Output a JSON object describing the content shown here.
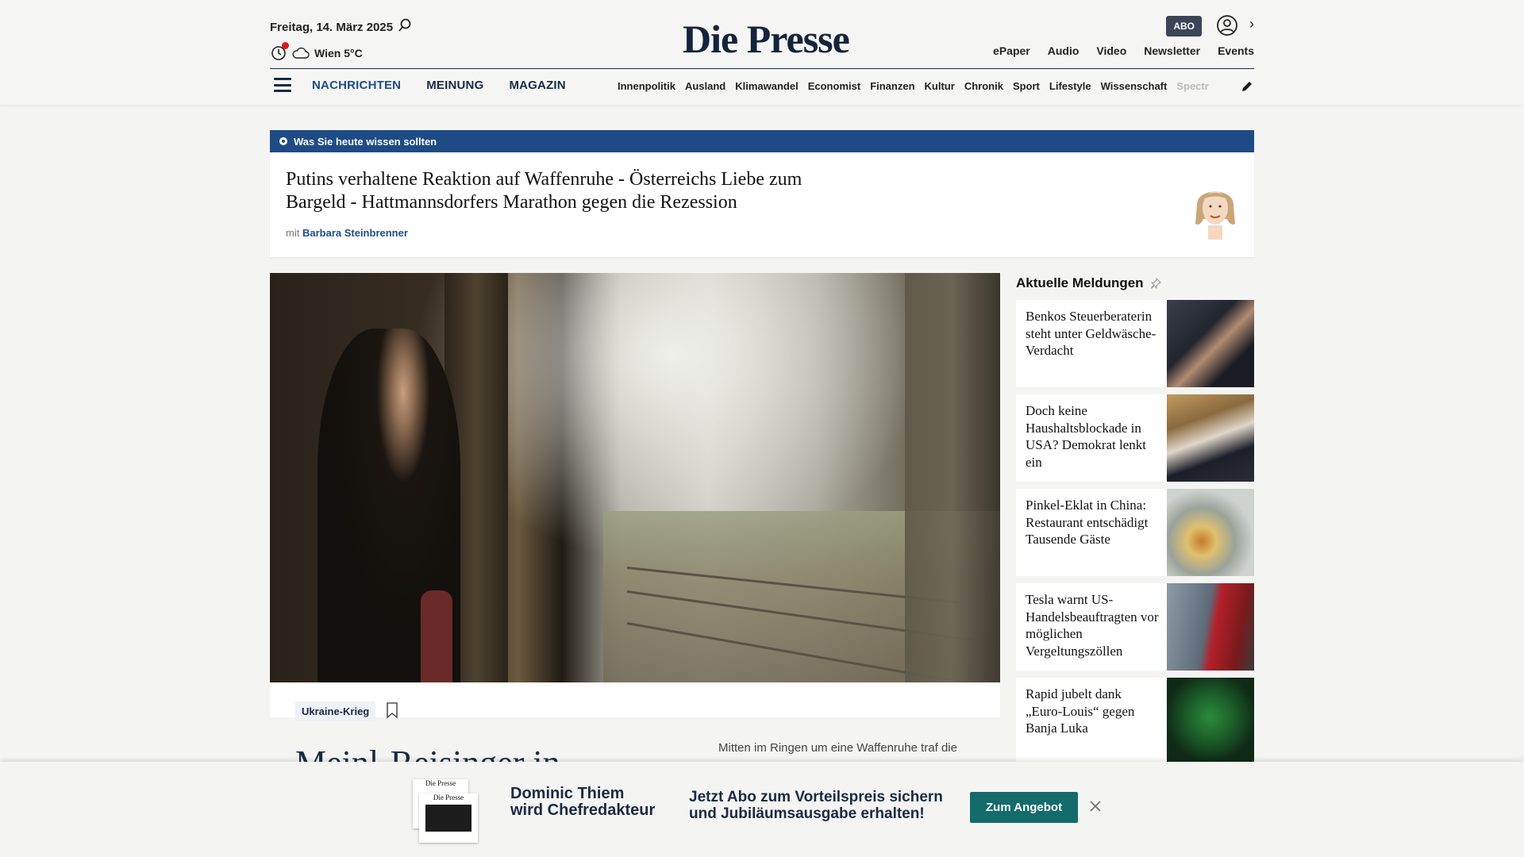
{
  "header": {
    "date": "Freitag, 14. März 2025",
    "weather": "Wien 5°C",
    "logo": "Die Presse",
    "abo": "ABO",
    "top_links": [
      "ePaper",
      "Audio",
      "Video",
      "Newsletter",
      "Events"
    ],
    "nav_main": [
      "NACHRICHTEN",
      "MEINUNG",
      "MAGAZIN"
    ],
    "nav_sub": [
      "Innenpolitik",
      "Ausland",
      "Klimawandel",
      "Economist",
      "Finanzen",
      "Kultur",
      "Chronik",
      "Sport",
      "Lifestyle",
      "Wissenschaft",
      "Spectr"
    ]
  },
  "today": {
    "label": "Was Sie heute wissen sollten",
    "headline": "Putins verhaltene Reaktion auf Waffenruhe - Österreichs Liebe zum Bargeld - Hattmannsdorfers Marathon gegen die Rezession",
    "author_prefix": "mit",
    "author": "Barbara Steinbrenner"
  },
  "lead": {
    "tag": "Ukraine-Krieg",
    "title": "Meinl-Reisinger in",
    "teaser": "Mitten im Ringen um eine Waffenruhe traf die"
  },
  "sidebar": {
    "title": "Aktuelle Meldungen",
    "items": [
      {
        "title": "Benkos Steuerberaterin steht unter Geldwäsche-Verdacht"
      },
      {
        "title": "Doch keine Haushaltsblockade in USA? Demokrat lenkt ein"
      },
      {
        "title": "Pinkel-Eklat in China: Restaurant entschädigt Tausende Gäste"
      },
      {
        "title": "Tesla warnt US-Handelsbeauftragten vor möglichen Vergeltungszöllen"
      },
      {
        "title": "Rapid jubelt dank „Euro-Louis“ gegen Banja Luka"
      }
    ]
  },
  "banner": {
    "headline_1": "Dominic Thiem",
    "headline_2": "wird Chefredakteur",
    "text_1": "Jetzt Abo zum Vorteilspreis sichern",
    "text_2": "und Jubiläumsausgabe erhalten!",
    "button": "Zum Angebot",
    "paper_logo": "Die Presse"
  },
  "colors": {
    "brand_navy": "#1a2a44",
    "accent_blue": "#1e4b85",
    "cta_teal": "#136b6b",
    "alert_red": "#d71920"
  },
  "icons": [
    "search-icon",
    "clock-icon",
    "cloud-icon",
    "user-icon",
    "chevron-right-icon",
    "menu-icon",
    "pen-icon",
    "bookmark-icon",
    "pin-icon",
    "close-icon"
  ]
}
